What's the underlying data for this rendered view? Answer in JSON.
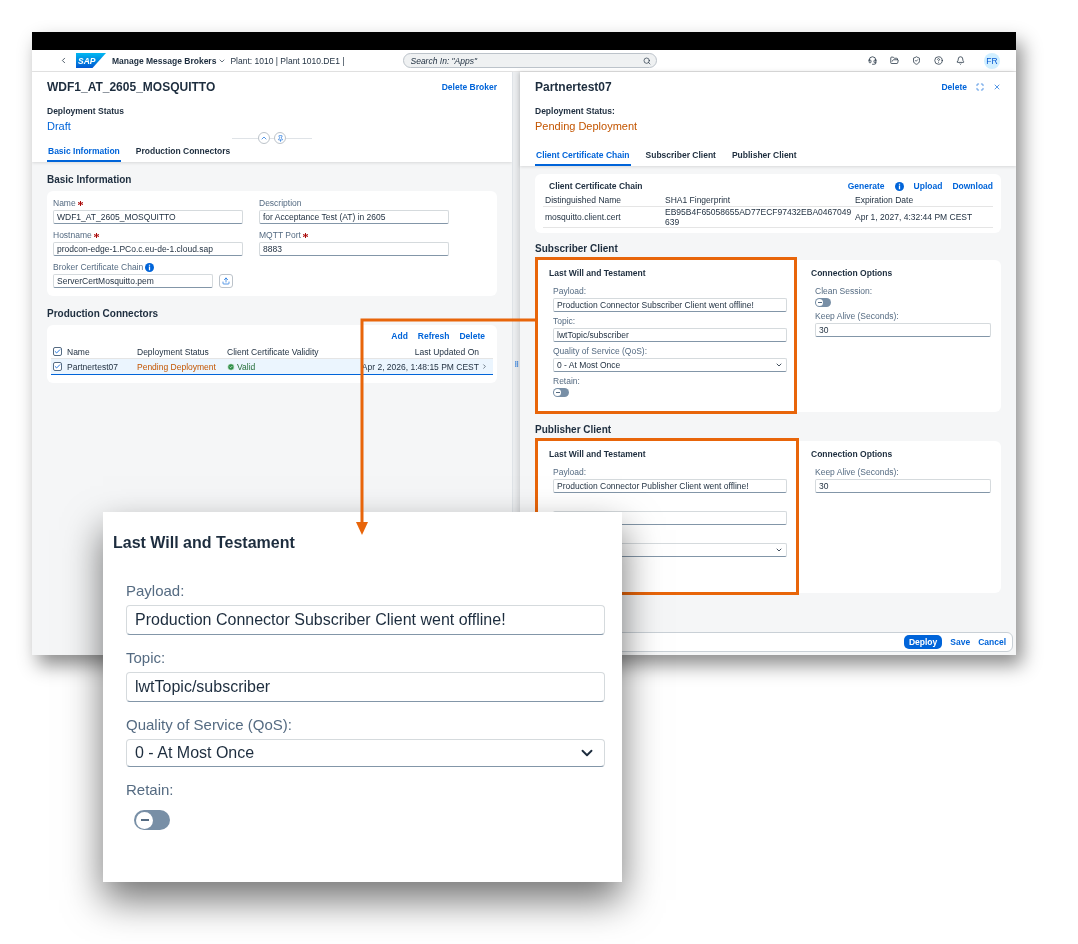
{
  "shell": {
    "logo": "SAP",
    "app_title": "Manage Message Brokers",
    "context": "Plant: 1010 | Plant 1010.DE1 |",
    "search": {
      "placeholder": "Search In: \"Apps\""
    },
    "avatar": "FR"
  },
  "broker": {
    "title": "WDF1_AT_2605_MOSQUITTO",
    "action": "Delete Broker",
    "status_label": "Deployment Status",
    "status": "Draft",
    "tabs": [
      {
        "label": "Basic Information",
        "selected": true
      },
      {
        "label": "Production Connectors",
        "selected": false
      }
    ],
    "basic_info": {
      "heading": "Basic Information",
      "fields": [
        {
          "label": "Name",
          "required": true,
          "value": "WDF1_AT_2605_MOSQUITTO"
        },
        {
          "label": "Description",
          "required": false,
          "value": "for Acceptance Test (AT) in 2605"
        },
        {
          "label": "Hostname",
          "required": true,
          "value": "prodcon-edge-1.PCo.c.eu-de-1.cloud.sap"
        },
        {
          "label": "MQTT Port",
          "required": true,
          "value": "8883"
        }
      ],
      "certificate": {
        "label": "Broker Certificate Chain",
        "value": "ServerCertMosquitto.pem"
      }
    },
    "connectors": {
      "heading": "Production Connectors",
      "actions": [
        "Add",
        "Refresh",
        "Delete"
      ],
      "select_all": true,
      "columns": [
        "Name",
        "Deployment Status",
        "Client Certificate Validity",
        "Last Updated On"
      ],
      "rows": [
        {
          "name": "Partnertest07",
          "status": "Pending Deployment",
          "validity": "Valid",
          "updated": "Apr 2, 2026, 1:48:15 PM CEST",
          "selected": true
        }
      ]
    }
  },
  "connector": {
    "title": "Partnertest07",
    "action": "Delete",
    "status_label": "Deployment Status:",
    "status": "Pending Deployment",
    "tabs": [
      {
        "label": "Client Certificate Chain",
        "selected": true
      },
      {
        "label": "Subscriber Client",
        "selected": false
      },
      {
        "label": "Publisher Client",
        "selected": false
      }
    ],
    "certificate_chain": {
      "heading": "Client Certificate Chain",
      "actions": [
        "Generate",
        "Upload",
        "Download"
      ],
      "columns": [
        "Distinguished Name",
        "SHA1 Fingerprint",
        "Expiration Date"
      ],
      "rows": [
        {
          "name": "mosquitto.client.cert",
          "fingerprint": "EB95B4F65058655AD77ECF97432EBA0467049639",
          "expiration": "Apr 1, 2027, 4:32:44 PM CEST"
        }
      ]
    },
    "subscriber": {
      "heading": "Subscriber Client",
      "lwt": {
        "heading": "Last Will and Testament",
        "payload_label": "Payload:",
        "payload": "Production Connector Subscriber Client went offline!",
        "topic_label": "Topic:",
        "topic": "lwtTopic/subscriber",
        "qos_label": "Quality of Service (QoS):",
        "qos": "0 - At Most Once",
        "retain_label": "Retain:",
        "retain": false
      },
      "options": {
        "heading": "Connection Options",
        "clean_session_label": "Clean Session:",
        "clean_session": false,
        "keep_alive_label": "Keep Alive (Seconds):",
        "keep_alive": "30"
      }
    },
    "publisher": {
      "heading": "Publisher Client",
      "lwt": {
        "heading": "Last Will and Testament",
        "payload_label": "Payload:",
        "payload": "Production Connector Publisher Client went offline!"
      },
      "options": {
        "heading": "Connection Options",
        "keep_alive_label": "Keep Alive (Seconds):",
        "keep_alive": "30"
      }
    },
    "footer": [
      "Deploy",
      "Save",
      "Cancel"
    ]
  },
  "callout": {
    "heading": "Last Will and Testament",
    "payload_label": "Payload:",
    "payload": "Production Connector Subscriber Client went offline!",
    "topic_label": "Topic:",
    "topic": "lwtTopic/subscriber",
    "qos_label": "Quality of Service (QoS):",
    "qos": "0 - At Most Once",
    "retain_label": "Retain:",
    "retain": false
  }
}
